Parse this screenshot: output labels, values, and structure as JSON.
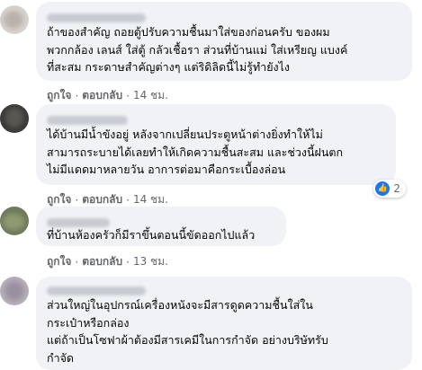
{
  "comments": [
    {
      "text": "ถ้าของสำคัญ ถอยตู้ปรับความชื้นมาใส่ของก่อนครับ ของผม\nพวกกล้อง เลนส์ ใส่ตู้ กลัวเชื้อรา ส่วนที่บ้านแม่ ใส่เหรียญ แบงค์\nที่สะสม กระดาษสำคัญต่างๆ แต่ริดิลิดนี้ไม่รู้ทำยังไง",
      "like": "ถูกใจ",
      "reply": "ตอบกลับ",
      "time": "14 ชม."
    },
    {
      "text": "ได้บ้านมีน้ำขังอยู่ หลังจากเปลี่ยนประตูหน้าต่างยิ่งทำให้ไม่\nสามารถระบายได้เลยทำให้เกิดความชื้นสะสม และช่วงนี้ฝนตก\nไม่มีแดดมาหลายวัน อาการต่อมาคือกระเบื้องล่อน",
      "like": "ถูกใจ",
      "reply": "ตอบกลับ",
      "time": "14 ชม.",
      "reaction_count": "2"
    },
    {
      "text": "ที่บ้านห้องครัวก็มีราขึ้นตอนนี้ขัดออกไปแล้ว",
      "like": "ถูกใจ",
      "reply": "ตอบกลับ",
      "time": "13 ชม."
    },
    {
      "text": "ส่วนใหญ่ในอุปกรณ์เครื่องหนังจะมีสารดูดความชื้นใส่ใน\nกระเป๋าหรือกล่อง\nแต่ถ้าเป็นโซฟาผ้าต้องมีสารเคมีในการกำจัด อย่างบริษัทรับ\nกำจัด"
    }
  ],
  "colors": {
    "bubble": "#f0f2f5",
    "text": "#050505",
    "meta": "#65676b",
    "like_blue": "#1877f2"
  },
  "icons": {
    "reaction": "thumbs-up-icon"
  }
}
